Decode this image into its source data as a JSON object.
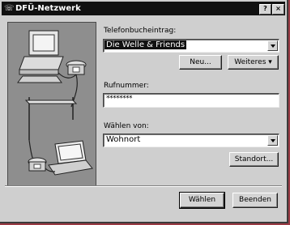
{
  "window": {
    "title": "DFÜ-Netzwerk"
  },
  "titlebar_buttons": {
    "help": "?",
    "close": "×"
  },
  "phonebook": {
    "label": "Telefonbucheintrag:",
    "selected": "Die Welle & Friends",
    "new_button": "Neu...",
    "more_button": "Weiteres ▾"
  },
  "phone_number": {
    "label": "Rufnummer:",
    "value": "********"
  },
  "dial_from": {
    "label": "Wählen von:",
    "selected": "Wohnort",
    "location_button": "Standort..."
  },
  "actions": {
    "dial": "Wählen",
    "close": "Beenden"
  }
}
